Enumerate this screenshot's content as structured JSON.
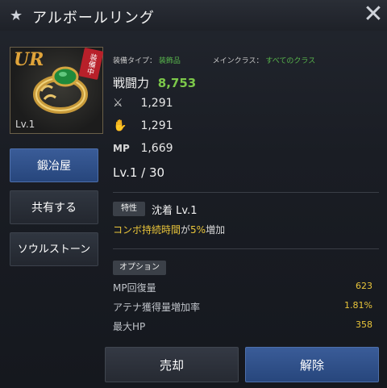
{
  "window": {
    "title": "アルボールリング"
  },
  "item": {
    "rarity": "UR",
    "badge": "装備中",
    "level": "Lv.1"
  },
  "side_buttons": {
    "smith": "鍛冶屋",
    "share": "共有する",
    "soul": "ソウルストーン"
  },
  "meta": {
    "type_label": "装備タイプ：",
    "type_value": "装飾品",
    "class_label": "メインクラス：",
    "class_value": "すべてのクラス"
  },
  "power": {
    "label": "戦闘力",
    "value": "8,753"
  },
  "stats": [
    {
      "icon": "crossed-swords-icon",
      "value": "1,291"
    },
    {
      "icon": "magic-hand-icon",
      "value": "1,291"
    },
    {
      "icon": "mp-icon",
      "value": "1,669",
      "icon_text": "MP"
    }
  ],
  "level": {
    "current": "Lv.1 / 30"
  },
  "trait": {
    "tag": "特性",
    "name": "沈着 Lv.1",
    "desc_pre": "コンボ持続時間",
    "desc_mid": "が",
    "desc_value": "5%",
    "desc_post": "増加"
  },
  "options": {
    "header": "オプション",
    "rows": [
      {
        "label": "MP回復量",
        "value": "623"
      },
      {
        "label": "アテナ獲得量増加率",
        "value": "1.81%"
      },
      {
        "label": "最大HP",
        "value": "358"
      }
    ]
  },
  "bottom_buttons": {
    "sell": "売却",
    "unequip": "解除"
  },
  "colors": {
    "accent_blue": "#3a5c98",
    "power_green": "#7cc84a",
    "value_yellow": "#e9c53a",
    "rarity_gold": "#e0a43a",
    "badge_red": "#b8202a"
  }
}
